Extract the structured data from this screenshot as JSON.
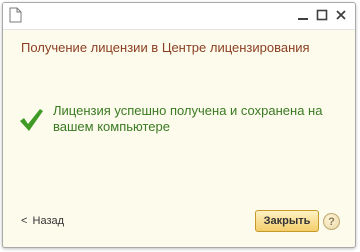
{
  "window": {
    "title_icon": "document-icon",
    "controls": [
      "minimize-icon",
      "maximize-icon",
      "close-icon"
    ]
  },
  "heading": "Получение лицензии в Центре лицензирования",
  "status": {
    "icon": "checkmark-icon",
    "message": "Лицензия успешно получена и сохранена на вашем компьютере"
  },
  "footer": {
    "back_label": "Назад",
    "close_label": "Закрыть",
    "help_label": "?"
  },
  "colors": {
    "background": "#fdfbec",
    "heading": "#8b3f22",
    "success": "#3a7a22",
    "button": "#f3cd6a"
  }
}
